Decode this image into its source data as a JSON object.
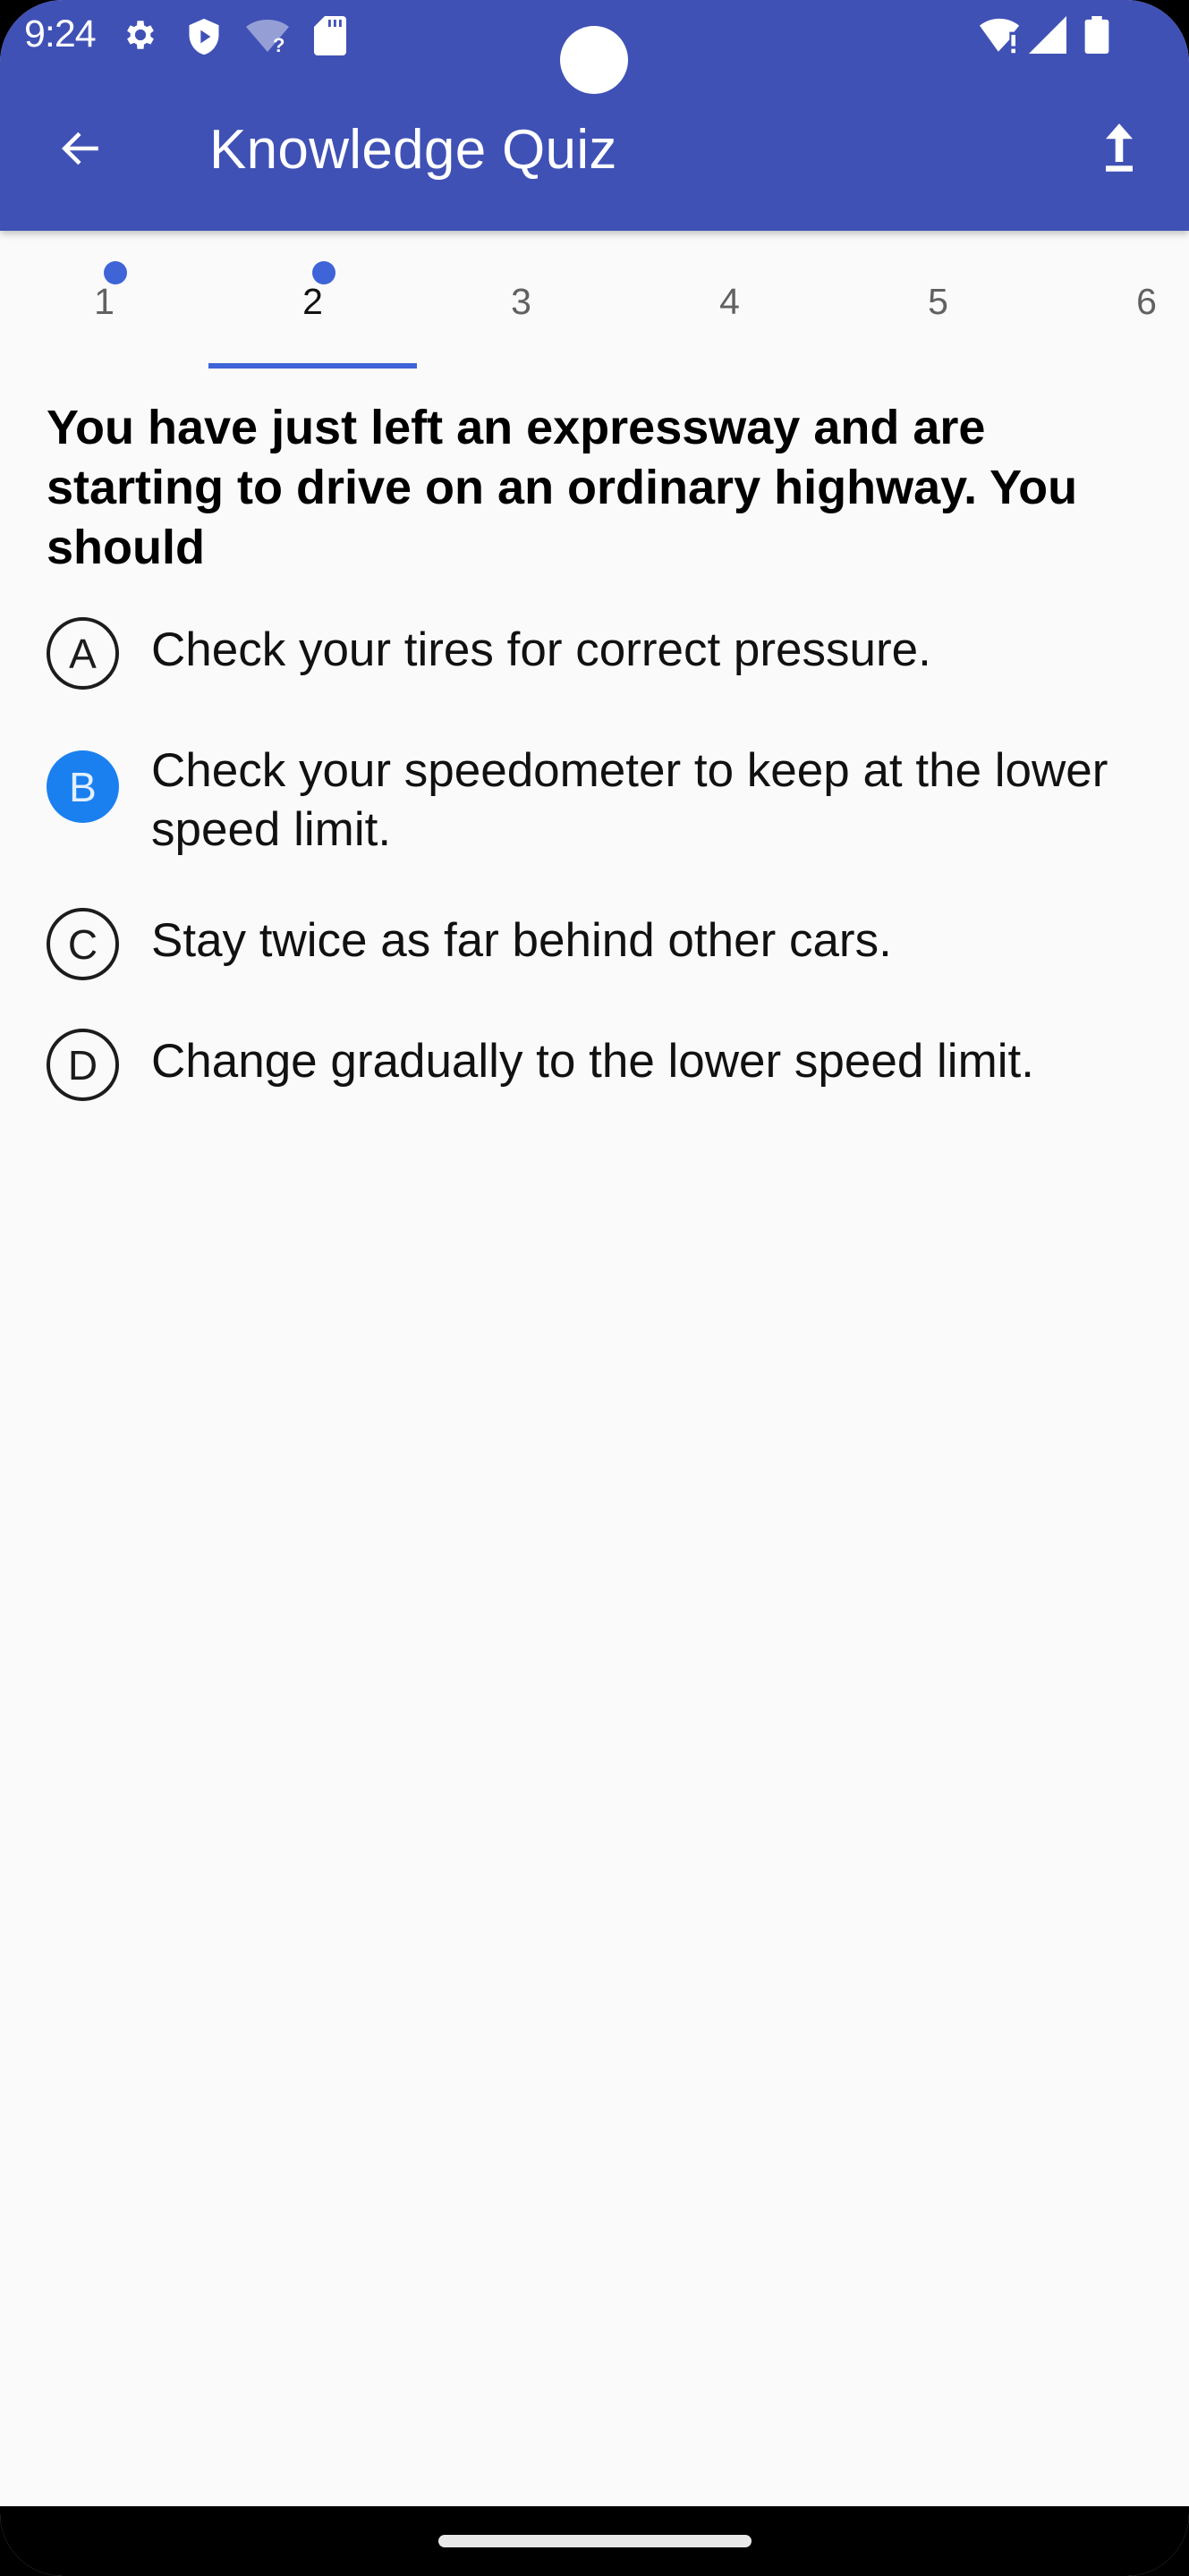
{
  "status_bar": {
    "time": "9:24",
    "left_icons": [
      "gear-icon",
      "shield-play-icon",
      "wifi-unknown-icon",
      "sd-card-icon"
    ],
    "right_icons": [
      "wifi-alert-icon",
      "cell-signal-icon",
      "battery-icon"
    ]
  },
  "app_bar": {
    "title": "Knowledge Quiz",
    "back_icon": "arrow-left-icon",
    "action_icon": "upload-icon"
  },
  "colors": {
    "primary": "#3f51b5",
    "accent": "#3f64d8",
    "selected_option": "#1a80f0"
  },
  "tabs": [
    {
      "label": "1",
      "answered": true,
      "active": false
    },
    {
      "label": "2",
      "answered": true,
      "active": true
    },
    {
      "label": "3",
      "answered": false,
      "active": false
    },
    {
      "label": "4",
      "answered": false,
      "active": false
    },
    {
      "label": "5",
      "answered": false,
      "active": false
    },
    {
      "label": "6",
      "answered": false,
      "active": false
    }
  ],
  "question": {
    "text": "You have just left an expressway and are starting to drive on an ordinary highway. You should",
    "options": [
      {
        "letter": "A",
        "text": "Check your tires for correct pressure.",
        "selected": false
      },
      {
        "letter": "B",
        "text": "Check your speedometer to keep at the lower speed limit.",
        "selected": true
      },
      {
        "letter": "C",
        "text": "Stay twice as far behind other cars.",
        "selected": false
      },
      {
        "letter": "D",
        "text": "Change gradually to the lower speed limit.",
        "selected": false
      }
    ]
  }
}
